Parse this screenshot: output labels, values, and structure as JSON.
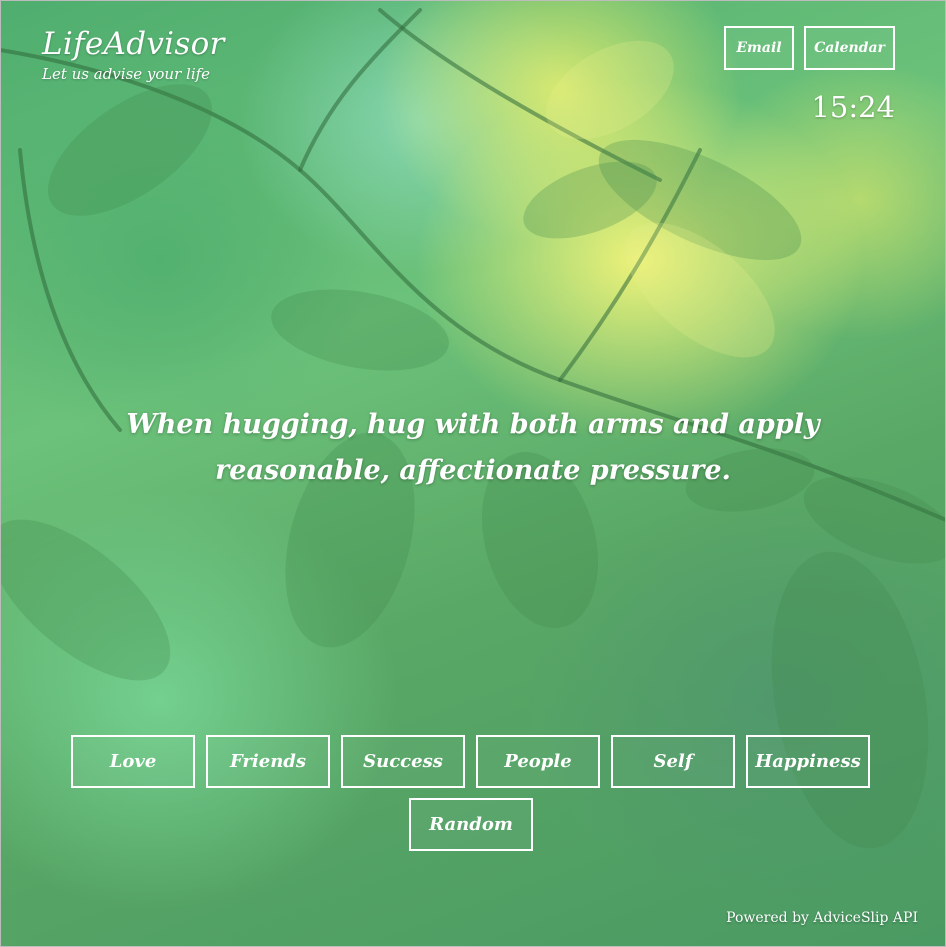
{
  "brand": {
    "title": "LifeAdvisor",
    "tagline": "Let us advise your life"
  },
  "header": {
    "email_label": "Email",
    "calendar_label": "Calendar",
    "clock": "15:24"
  },
  "advice": {
    "text": "When hugging, hug with both arms and apply reasonable, affectionate pressure."
  },
  "categories": [
    {
      "label": "Love"
    },
    {
      "label": "Friends"
    },
    {
      "label": "Success"
    },
    {
      "label": "People"
    },
    {
      "label": "Self"
    },
    {
      "label": "Happiness"
    },
    {
      "label": "Random"
    }
  ],
  "footer": {
    "credit": "Powered by AdviceSlip API"
  },
  "colors": {
    "text": "#ffffff",
    "button_border": "#ffffff",
    "background_green": "#5aa866",
    "background_yellow": "#f5f578"
  }
}
